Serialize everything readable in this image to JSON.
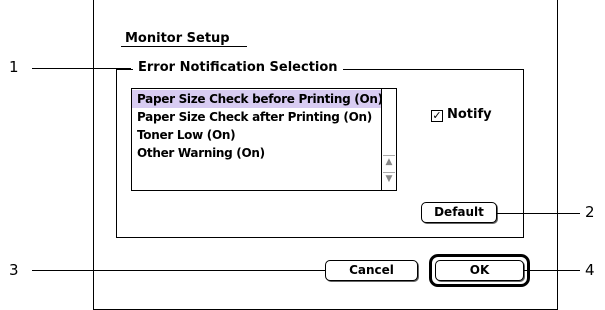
{
  "dialog": {
    "tab_title": "Monitor Setup",
    "group_label": "Error Notification Selection",
    "list_items": [
      "Paper Size Check before Printing (On)",
      "Paper Size Check after Printing (On)",
      "Toner Low (On)",
      "Other Warning (On)"
    ],
    "selected_index": 0,
    "notify_label": "Notify",
    "notify_checked": true,
    "notify_check_glyph": "✓",
    "scroll_up_glyph": "▲",
    "scroll_down_glyph": "▼",
    "buttons": {
      "default": "Default",
      "cancel": "Cancel",
      "ok": "OK"
    }
  },
  "callouts": [
    "1",
    "2",
    "3",
    "4"
  ],
  "colors": {
    "selection": "#d8ccf2"
  }
}
